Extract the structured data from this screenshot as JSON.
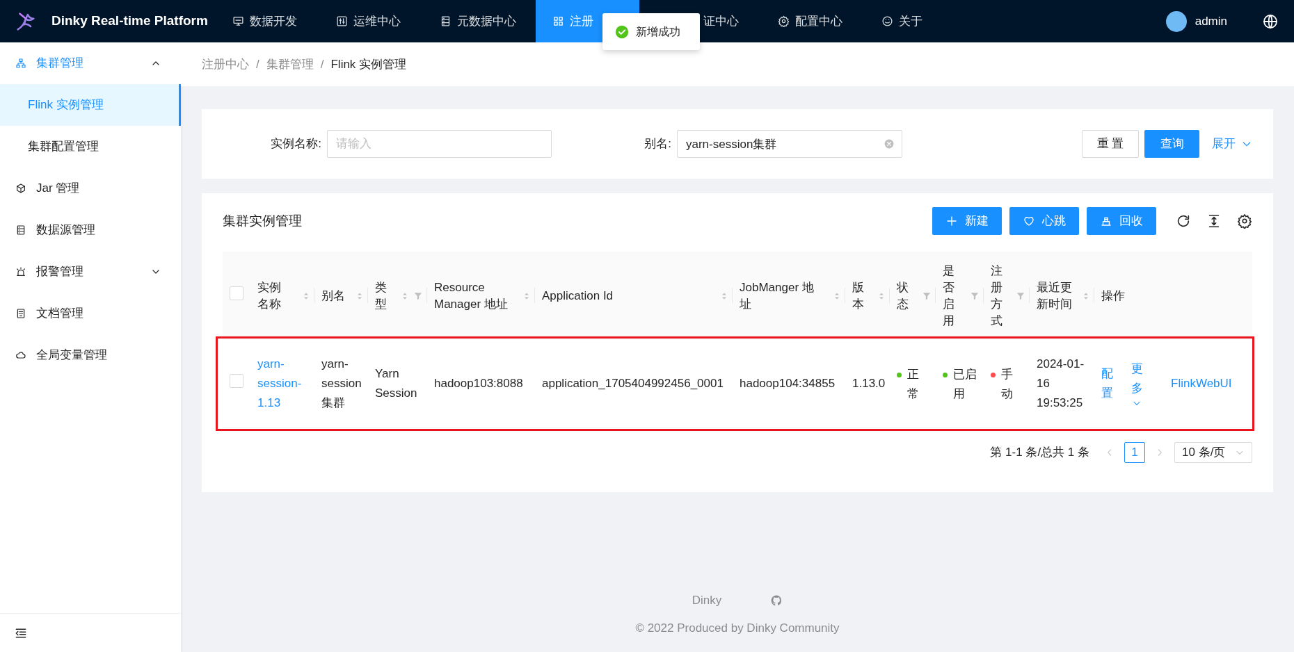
{
  "header": {
    "title": "Dinky Real-time Platform",
    "nav": [
      {
        "label": "数据开发",
        "selected": false
      },
      {
        "label": "运维中心",
        "selected": false
      },
      {
        "label": "元数据中心",
        "selected": false
      },
      {
        "label": "注册",
        "selected": true
      },
      {
        "label": "证中心",
        "selected": false
      },
      {
        "label": "配置中心",
        "selected": false
      },
      {
        "label": "关于",
        "selected": false
      }
    ],
    "user": "admin"
  },
  "toast": {
    "message": "新增成功"
  },
  "sidebar": {
    "items": [
      {
        "label": "集群管理",
        "selected": false,
        "expanded": true,
        "children": [
          {
            "label": "Flink 实例管理",
            "selected": true
          },
          {
            "label": "集群配置管理",
            "selected": false
          }
        ]
      },
      {
        "label": "Jar 管理",
        "selected": false
      },
      {
        "label": "数据源管理",
        "selected": false
      },
      {
        "label": "报警管理",
        "selected": false,
        "expanded": false
      },
      {
        "label": "文档管理",
        "selected": false
      },
      {
        "label": "全局变量管理",
        "selected": false
      }
    ]
  },
  "breadcrumb": {
    "items": [
      "注册中心",
      "集群管理",
      "Flink 实例管理"
    ],
    "separators": [
      "/",
      "/"
    ]
  },
  "search": {
    "fields": [
      {
        "label": "实例名称:",
        "placeholder": "请输入"
      },
      {
        "label": "别名:",
        "value": "yarn-session集群"
      }
    ],
    "reset": "重 置",
    "query": "查询",
    "expand": "展开"
  },
  "table": {
    "title": "集群实例管理",
    "actions": [
      {
        "label": "新建"
      },
      {
        "label": "心跳"
      },
      {
        "label": "回收"
      }
    ],
    "select_all": {
      "checked": false
    },
    "columns": [
      {
        "label": "实例名称",
        "sortable": true,
        "filterable": false
      },
      {
        "label": "别名",
        "sortable": true,
        "filterable": false
      },
      {
        "label": "类型",
        "sortable": true,
        "filterable": true
      },
      {
        "label": "Resource Manager 地址",
        "sortable": true,
        "filterable": false
      },
      {
        "label": "Application Id",
        "sortable": true,
        "filterable": false
      },
      {
        "label": "JobManger 地址",
        "sortable": true,
        "filterable": false
      },
      {
        "label": "版本",
        "sortable": true,
        "filterable": false
      },
      {
        "label": "状态",
        "sortable": false,
        "filterable": true
      },
      {
        "label": "是否启用",
        "sortable": false,
        "filterable": true
      },
      {
        "label": "注册方式",
        "sortable": false,
        "filterable": true
      },
      {
        "label": "最近更新时间",
        "sortable": true,
        "filterable": false
      },
      {
        "label": "操作",
        "sortable": false,
        "filterable": false
      }
    ],
    "rows": [
      {
        "checked": false,
        "highlighted": true,
        "name": "yarn-session-1.13",
        "alias": "yarn-session集群",
        "type": "Yarn Session",
        "resource_manager": "hadoop103:8088",
        "application_id": "application_1705404992456_0001",
        "job_manager": "hadoop104:34855",
        "version": "1.13.0",
        "status": {
          "text": "正常",
          "color": "#52c41a"
        },
        "enabled": {
          "text": "已启用",
          "color": "#52c41a"
        },
        "register": {
          "text": "手动",
          "color": "#ff4d4f"
        },
        "updated": "2024-01-16 19:53:25",
        "ops": {
          "config": "配置",
          "more": "更多",
          "web_ui": "FlinkWebUI"
        }
      }
    ]
  },
  "pagination": {
    "summary": "第 1-1 条/总共 1 条",
    "pages": [
      {
        "label": "1",
        "selected": true
      }
    ],
    "page_size": "10 条/页"
  },
  "footer": {
    "brand": "Dinky",
    "copyright": "© 2022 Produced by Dinky Community"
  }
}
